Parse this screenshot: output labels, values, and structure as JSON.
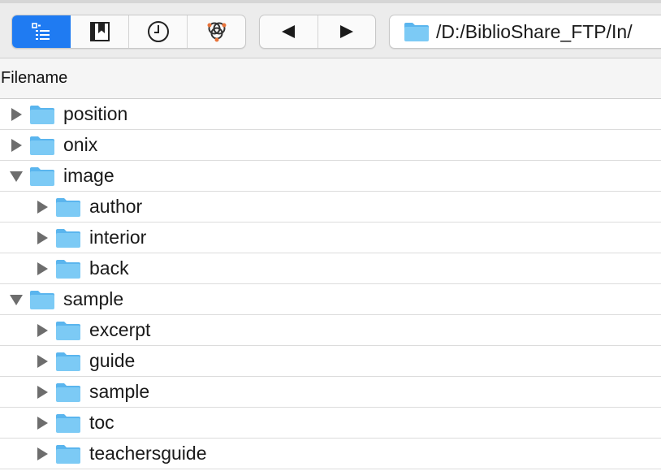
{
  "toolbar": {
    "view_buttons": [
      {
        "icon": "outline-view-icon",
        "active": true
      },
      {
        "icon": "bookmarks-icon",
        "active": false
      },
      {
        "icon": "history-clock-icon",
        "active": false
      },
      {
        "icon": "sync-network-icon",
        "active": false
      }
    ],
    "back_icon": "back-arrow-icon",
    "forward_icon": "forward-arrow-icon",
    "path": "/D:/BiblioShare_FTP/In/"
  },
  "columns": {
    "filename": "Filename"
  },
  "rows": [
    {
      "name": "position",
      "level": 0,
      "expanded": false
    },
    {
      "name": "onix",
      "level": 0,
      "expanded": false
    },
    {
      "name": "image",
      "level": 0,
      "expanded": true
    },
    {
      "name": "author",
      "level": 1,
      "expanded": false
    },
    {
      "name": "interior",
      "level": 1,
      "expanded": false
    },
    {
      "name": "back",
      "level": 1,
      "expanded": false
    },
    {
      "name": "sample",
      "level": 0,
      "expanded": true
    },
    {
      "name": "excerpt",
      "level": 1,
      "expanded": false
    },
    {
      "name": "guide",
      "level": 1,
      "expanded": false
    },
    {
      "name": "sample",
      "level": 1,
      "expanded": false
    },
    {
      "name": "toc",
      "level": 1,
      "expanded": false
    },
    {
      "name": "teachersguide",
      "level": 1,
      "expanded": false
    }
  ],
  "colors": {
    "accent": "#1f7bf2",
    "folder": "#7ccaf5",
    "folder_tab": "#5ab5ee",
    "disclosure": "#6d6d6d"
  }
}
